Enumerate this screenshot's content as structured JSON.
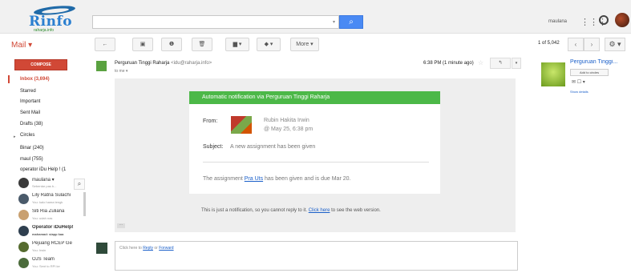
{
  "header": {
    "logo_text": "Rinfo",
    "logo_sub": "raharja.info",
    "search_placeholder": "",
    "user_name": "maulana"
  },
  "toolbar": {
    "app_label": "Mail ▾",
    "back": "←",
    "archive": "▣",
    "spam": "❶",
    "delete": "🗑",
    "move": "▆ ▾",
    "labels": "◆ ▾",
    "more": "More ▾",
    "paging": "1 of 5,042",
    "prev": "‹",
    "next": "›",
    "settings": "⚙ ▾"
  },
  "sidebar": {
    "compose": "COMPOSE",
    "items": [
      {
        "label": "Inbox (3,694)"
      },
      {
        "label": "Starred"
      },
      {
        "label": "Important"
      },
      {
        "label": "Sent Mail"
      },
      {
        "label": "Drafts (38)"
      },
      {
        "label": "Circles"
      },
      {
        "label": "Binar (240)"
      },
      {
        "label": "maul (755)"
      },
      {
        "label": "operator iDu Help ! (1"
      }
    ],
    "circles_arrow": "▸"
  },
  "chat": {
    "me_name": "maulana ▾",
    "me_status": "Sebentar pas b...",
    "contacts": [
      {
        "name": "Lily Ratna Sulachi",
        "status": "You: kalo hama tengk"
      },
      {
        "name": "Siti Ria Zuliana",
        "status": "You: udah nas"
      },
      {
        "name": "Operator iDuHelp!",
        "status": "mahamad: siapp kaa"
      },
      {
        "name": "Pejuang RCEP Ge",
        "status": "You: hwin"
      },
      {
        "name": "OJS Team",
        "status": "You: Sent to RPI ke"
      }
    ]
  },
  "message": {
    "sender_name": "Perguruan Tinggi Raharja",
    "sender_addr": "<idu@raharja.info>",
    "to": "to me ▾",
    "time": "6:38 PM (1 minute ago)",
    "star": "☆",
    "reply": "↰ ",
    "more": "▾",
    "card_header": "Automatic notification via Perguruan Tinggi Raharja",
    "from_label": "From:",
    "from_name": "Rubin Hakita Irwin",
    "from_date": "@ May 25, 6:38 pm",
    "subject_label": "Subject:",
    "subject_text": "A new assignment has been given",
    "assign_pre": "The assignment ",
    "assign_link": "Pra Uts",
    "assign_post": " has been given and is due Mar 20.",
    "notice_pre": "This is just a notification, so you cannot reply to it. ",
    "notice_link": "Click here",
    "notice_post": " to see the web version.",
    "ellipsis": "···"
  },
  "reply_box": {
    "pre": "Click here to ",
    "reply": "Reply",
    "mid": " or ",
    "forward": "Forward"
  },
  "right_panel": {
    "name": "Perguruan Tinggi...",
    "add_btn": "Add to circles",
    "icons": "✉ ☐ ▾",
    "details": "Show details"
  }
}
